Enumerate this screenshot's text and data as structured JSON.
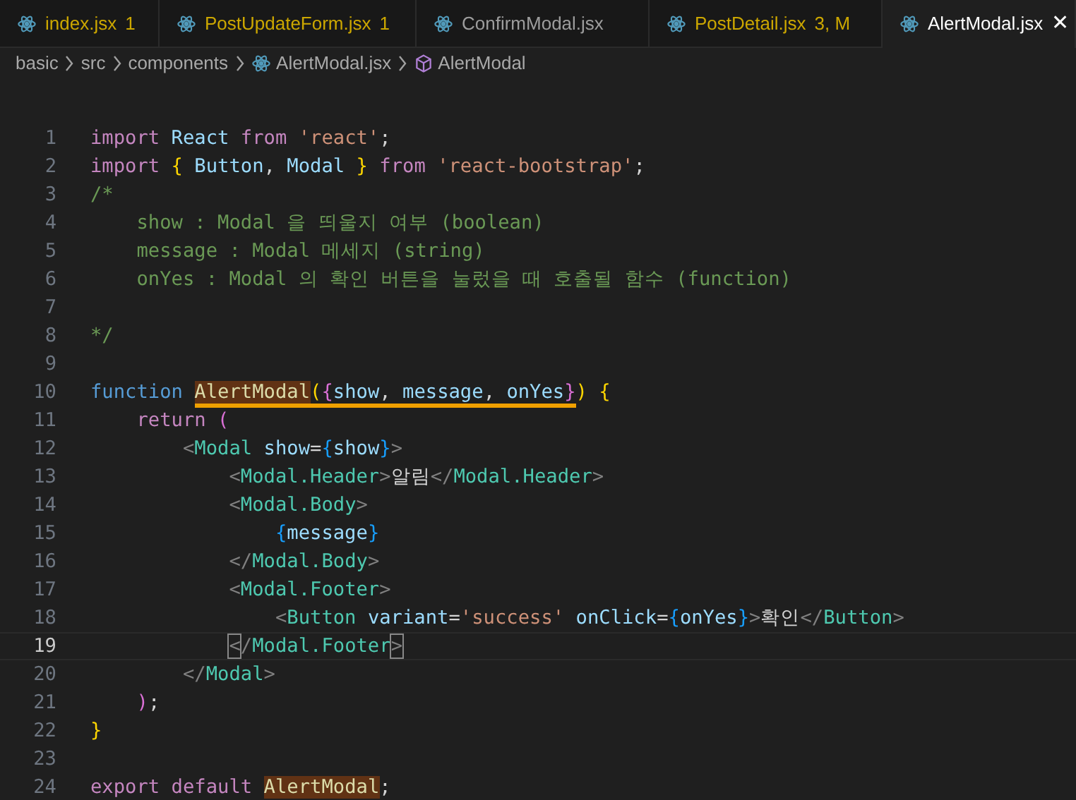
{
  "tabs": [
    {
      "label": "index.jsx",
      "badge": "1",
      "warning": true,
      "selected": false
    },
    {
      "label": "PostUpdateForm.jsx",
      "badge": "1",
      "warning": true,
      "selected": false
    },
    {
      "label": "ConfirmModal.jsx",
      "warning": false,
      "selected": false
    },
    {
      "label": "PostDetail.jsx",
      "badge": "3, M",
      "warning": true,
      "selected": false
    },
    {
      "label": "AlertModal.jsx",
      "warning": false,
      "selected": true,
      "close": "✕"
    }
  ],
  "breadcrumbs": [
    {
      "kind": "folder",
      "text": "basic"
    },
    {
      "kind": "folder",
      "text": "src"
    },
    {
      "kind": "folder",
      "text": "components"
    },
    {
      "kind": "file",
      "text": "AlertModal.jsx"
    },
    {
      "kind": "symbol",
      "text": "AlertModal"
    }
  ],
  "lines": [
    {
      "n": "1",
      "active": false,
      "tokens": [
        {
          "kind": "kw",
          "text": "import "
        },
        {
          "kind": "var",
          "text": "React "
        },
        {
          "kind": "kw",
          "text": "from "
        },
        {
          "kind": "str",
          "text": "'react'"
        },
        {
          "kind": "p",
          "text": ";"
        }
      ]
    },
    {
      "n": "2",
      "active": false,
      "tokens": [
        {
          "kind": "kw",
          "text": "import "
        },
        {
          "kind": "b1",
          "text": "{ "
        },
        {
          "kind": "var",
          "text": "Button"
        },
        {
          "kind": "p",
          "text": ", "
        },
        {
          "kind": "var",
          "text": "Modal "
        },
        {
          "kind": "b1",
          "text": "} "
        },
        {
          "kind": "kw",
          "text": "from "
        },
        {
          "kind": "str",
          "text": "'react-bootstrap'"
        },
        {
          "kind": "p",
          "text": ";"
        }
      ]
    },
    {
      "n": "3",
      "active": false,
      "tokens": [
        {
          "kind": "cm",
          "text": "/*"
        }
      ]
    },
    {
      "n": "4",
      "active": false,
      "tokens": [
        {
          "kind": "cm",
          "text": "    show : Modal 을 띄울지 여부 (boolean)"
        }
      ]
    },
    {
      "n": "5",
      "active": false,
      "tokens": [
        {
          "kind": "cm",
          "text": "    message : Modal 메세지 (string)"
        }
      ]
    },
    {
      "n": "6",
      "active": false,
      "tokens": [
        {
          "kind": "cm",
          "text": "    onYes : Modal 의 확인 버튼을 눌렀을 때 호출될 함수 (function)"
        }
      ]
    },
    {
      "n": "7",
      "active": false
    },
    {
      "n": "8",
      "active": false,
      "tokens": [
        {
          "kind": "cm",
          "text": "*/"
        }
      ]
    },
    {
      "n": "9",
      "active": false
    },
    {
      "n": "10",
      "active": false,
      "tokens": [
        {
          "kind": "st",
          "text": "function "
        },
        {
          "kind": "fn",
          "text": "AlertModal",
          "hl": true,
          "ul": true
        },
        {
          "kind": "b1",
          "text": "(",
          "hl": false,
          "ul": true
        },
        {
          "kind": "b2",
          "text": "{",
          "hl": false,
          "ul": true
        },
        {
          "kind": "var",
          "text": "show",
          "hl": false,
          "ul": true
        },
        {
          "kind": "p",
          "text": ", ",
          "hl": false,
          "ul": true
        },
        {
          "kind": "var",
          "text": "message",
          "hl": false,
          "ul": true
        },
        {
          "kind": "p",
          "text": ", ",
          "hl": false,
          "ul": true
        },
        {
          "kind": "var",
          "text": "onYes",
          "hl": false,
          "ul": true
        },
        {
          "kind": "b2",
          "text": "}",
          "hl": false,
          "ul": true
        },
        {
          "kind": "b1",
          "text": ") "
        },
        {
          "kind": "b1",
          "text": "{"
        }
      ]
    },
    {
      "n": "11",
      "active": false,
      "tokens": [
        {
          "kind": "kw",
          "text": "    return "
        },
        {
          "kind": "b2",
          "text": "("
        }
      ]
    },
    {
      "n": "12",
      "active": false,
      "tokens": [
        {
          "kind": "tp",
          "text": "        <"
        },
        {
          "kind": "tag",
          "text": "Modal "
        },
        {
          "kind": "var",
          "text": "show"
        },
        {
          "kind": "p",
          "text": "="
        },
        {
          "kind": "b3",
          "text": "{"
        },
        {
          "kind": "var",
          "text": "show"
        },
        {
          "kind": "b3",
          "text": "}"
        },
        {
          "kind": "tp",
          "text": ">"
        }
      ]
    },
    {
      "n": "13",
      "active": false,
      "tokens": [
        {
          "kind": "tp",
          "text": "            <"
        },
        {
          "kind": "tag",
          "text": "Modal.Header"
        },
        {
          "kind": "tp",
          "text": ">"
        },
        {
          "kind": "text",
          "text": "알림"
        },
        {
          "kind": "tp",
          "text": "</"
        },
        {
          "kind": "tag",
          "text": "Modal.Header"
        },
        {
          "kind": "tp",
          "text": ">"
        }
      ]
    },
    {
      "n": "14",
      "active": false,
      "tokens": [
        {
          "kind": "tp",
          "text": "            <"
        },
        {
          "kind": "tag",
          "text": "Modal.Body"
        },
        {
          "kind": "tp",
          "text": ">"
        }
      ]
    },
    {
      "n": "15",
      "active": false,
      "tokens": [
        {
          "kind": "b3",
          "text": "                {"
        },
        {
          "kind": "var",
          "text": "message"
        },
        {
          "kind": "b3",
          "text": "}"
        }
      ]
    },
    {
      "n": "16",
      "active": false,
      "tokens": [
        {
          "kind": "tp",
          "text": "            </"
        },
        {
          "kind": "tag",
          "text": "Modal.Body"
        },
        {
          "kind": "tp",
          "text": ">"
        }
      ]
    },
    {
      "n": "17",
      "active": false,
      "tokens": [
        {
          "kind": "tp",
          "text": "            <"
        },
        {
          "kind": "tag",
          "text": "Modal.Footer"
        },
        {
          "kind": "tp",
          "text": ">"
        }
      ]
    },
    {
      "n": "18",
      "active": false,
      "tokens": [
        {
          "kind": "tp",
          "text": "                <"
        },
        {
          "kind": "tag",
          "text": "Button "
        },
        {
          "kind": "var",
          "text": "variant"
        },
        {
          "kind": "p",
          "text": "="
        },
        {
          "kind": "str",
          "text": "'success' "
        },
        {
          "kind": "var",
          "text": "onClick"
        },
        {
          "kind": "p",
          "text": "="
        },
        {
          "kind": "b3",
          "text": "{"
        },
        {
          "kind": "var",
          "text": "onYes"
        },
        {
          "kind": "b3",
          "text": "}"
        },
        {
          "kind": "tp",
          "text": ">"
        },
        {
          "kind": "text",
          "text": "확인"
        },
        {
          "kind": "tp",
          "text": "</"
        },
        {
          "kind": "tag",
          "text": "Button"
        },
        {
          "kind": "tp",
          "text": ">"
        }
      ]
    },
    {
      "n": "19",
      "active": true,
      "tokens": [
        {
          "kind": "tp",
          "text": "            <",
          "boxed": true
        },
        {
          "kind": "tp",
          "text": "/",
          "boxed": false
        },
        {
          "kind": "tag",
          "text": "Modal.Footer"
        },
        {
          "kind": "tp",
          "text": ">",
          "boxed": true
        }
      ]
    },
    {
      "n": "20",
      "active": false,
      "tokens": [
        {
          "kind": "tp",
          "text": "        </"
        },
        {
          "kind": "tag",
          "text": "Modal"
        },
        {
          "kind": "tp",
          "text": ">"
        }
      ]
    },
    {
      "n": "21",
      "active": false,
      "tokens": [
        {
          "kind": "b2",
          "text": "    )"
        },
        {
          "kind": "p",
          "text": ";"
        }
      ]
    },
    {
      "n": "22",
      "active": false,
      "tokens": [
        {
          "kind": "b1",
          "text": "}"
        }
      ]
    },
    {
      "n": "23",
      "active": false
    },
    {
      "n": "24",
      "active": false,
      "tokens": [
        {
          "kind": "kw",
          "text": "export "
        },
        {
          "kind": "kw",
          "text": "default "
        },
        {
          "kind": "fn",
          "text": "AlertModal",
          "hl": true
        },
        {
          "kind": "p",
          "text": ";"
        }
      ]
    }
  ]
}
